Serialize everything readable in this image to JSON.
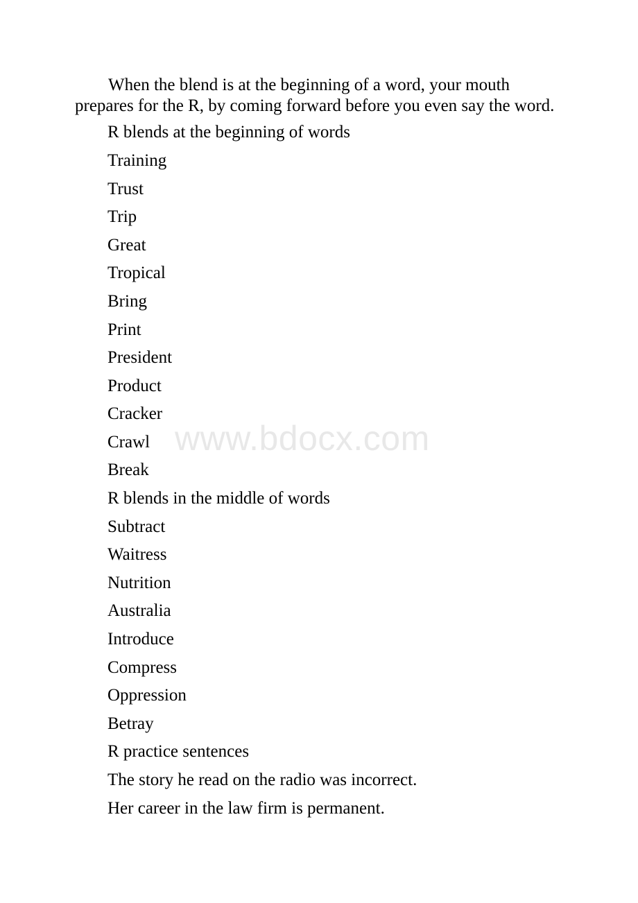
{
  "document": {
    "watermark": "www.bdocx.com",
    "watermark_color": "#e8e8e8",
    "text_color": "#000000",
    "background_color": "#ffffff",
    "intro_paragraph": "When the blend is at the beginning of a word, your mouth prepares for the R, by coming forward before you even say the word.",
    "sections": [
      {
        "heading": "R blends at the beginning of words",
        "items": [
          "Training",
          "Trust",
          "Trip",
          "Great",
          "Tropical",
          "Bring",
          "Print",
          "President",
          "Product",
          "Cracker",
          "Crawl",
          "Break"
        ]
      },
      {
        "heading": "R blends in the middle of words",
        "items": [
          "Subtract",
          "Waitress",
          "Nutrition",
          "Australia",
          "Introduce",
          "Compress",
          "Oppression",
          "Betray"
        ]
      },
      {
        "heading": "R practice sentences",
        "items": [
          "The story he read on the radio was incorrect.",
          "Her career in the law firm is permanent."
        ]
      }
    ]
  }
}
